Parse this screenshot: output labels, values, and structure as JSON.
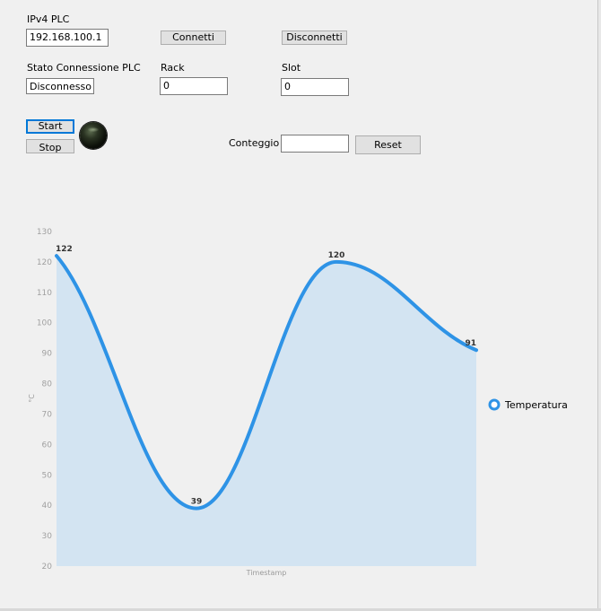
{
  "connection": {
    "ip_label": "IPv4 PLC",
    "ip_value": "192.168.100.1",
    "connect_label": "Connetti",
    "disconnect_label": "Disconnetti",
    "status_label": "Stato Connessione PLC",
    "status_value": "Disconnesso",
    "rack_label": "Rack",
    "rack_value": "0",
    "slot_label": "Slot",
    "slot_value": "0"
  },
  "controls": {
    "start_label": "Start",
    "stop_label": "Stop",
    "indicator_icon": "status-led-icon",
    "indicator_state": "off",
    "counter_label": "Conteggio",
    "counter_value": "",
    "reset_label": "Reset"
  },
  "chart_data": {
    "type": "area",
    "title": "",
    "xlabel": "Timestamp",
    "ylabel": "°C",
    "ylim": [
      20,
      130
    ],
    "yticks": [
      "130",
      "120",
      "110",
      "100",
      "90",
      "80",
      "70",
      "60",
      "50",
      "40",
      "30",
      "20"
    ],
    "grid": false,
    "legend_position": "right",
    "series": [
      {
        "name": "Temperatura",
        "values": [
          122,
          39,
          120,
          91
        ],
        "data_labels": [
          "122",
          "39",
          "120",
          "91"
        ],
        "line_color": "#2e93e6",
        "fill_color": "#d3e4f2"
      }
    ]
  }
}
